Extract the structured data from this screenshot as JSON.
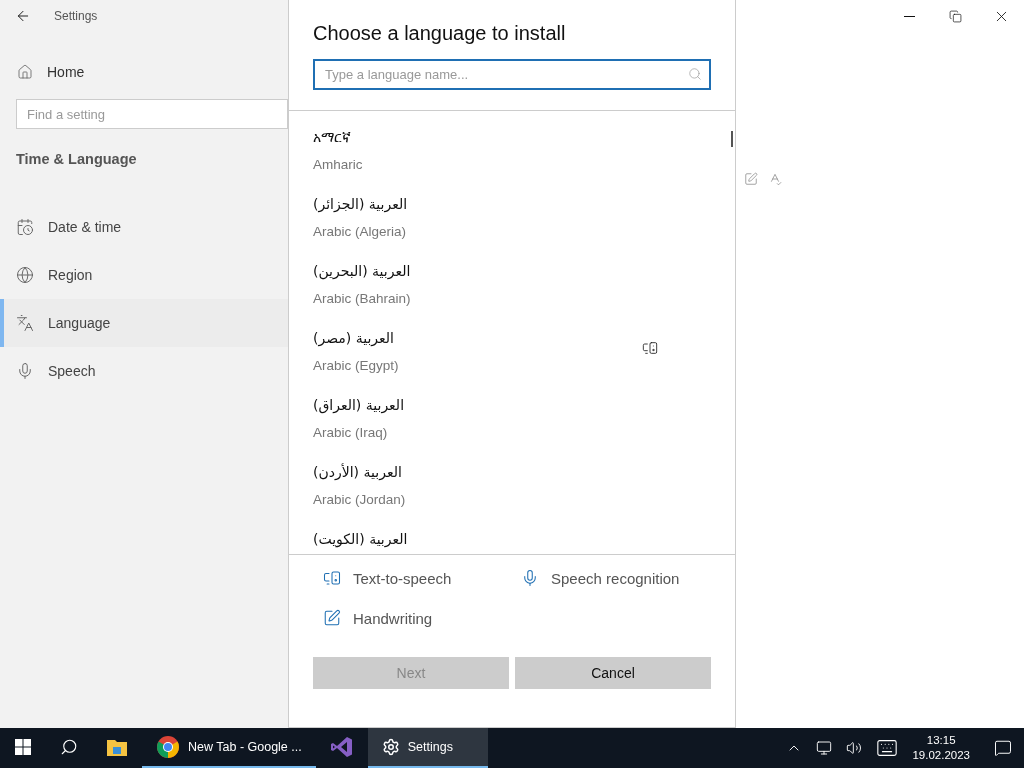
{
  "window": {
    "title": "Settings"
  },
  "sidebar": {
    "home": "Home",
    "search": {
      "placeholder": "Find a setting"
    },
    "heading": "Time & Language",
    "items": [
      {
        "label": "Date & time",
        "kind": "calendar",
        "selected": false
      },
      {
        "label": "Region",
        "kind": "globe",
        "selected": false
      },
      {
        "label": "Language",
        "kind": "language",
        "selected": true
      },
      {
        "label": "Speech",
        "kind": "mic",
        "selected": false
      }
    ]
  },
  "dialog": {
    "title": "Choose a language to install",
    "search": {
      "placeholder": "Type a language name..."
    },
    "languages": [
      {
        "native": "አማርኛ",
        "name": "Amharic",
        "text_to_speech": false
      },
      {
        "native": "العربية (الجزائر)",
        "name": "Arabic (Algeria)",
        "text_to_speech": false
      },
      {
        "native": "العربية (البحرين)",
        "name": "Arabic (Bahrain)",
        "text_to_speech": false
      },
      {
        "native": "العربية (مصر)",
        "name": "Arabic (Egypt)",
        "text_to_speech": true
      },
      {
        "native": "العربية (العراق)",
        "name": "Arabic (Iraq)",
        "text_to_speech": false
      },
      {
        "native": "العربية (الأردن)",
        "name": "Arabic (Jordan)",
        "text_to_speech": false
      },
      {
        "native": "العربية (الكويت)",
        "text_to_speech": false
      }
    ],
    "features": [
      {
        "label": "Text-to-speech",
        "kind": "tts"
      },
      {
        "label": "Speech recognition",
        "kind": "mic"
      },
      {
        "label": "Handwriting",
        "kind": "pen"
      }
    ],
    "buttons": [
      {
        "label": "Next",
        "disabled": true
      },
      {
        "label": "Cancel",
        "disabled": false
      }
    ]
  },
  "taskbar": {
    "apps": [
      {
        "kind": "explorer",
        "selected": false,
        "running": false
      },
      {
        "kind": "chrome",
        "label": "New Tab - Google ...",
        "selected": false,
        "running": true
      },
      {
        "kind": "vs",
        "selected": false,
        "running": false
      },
      {
        "kind": "settings",
        "label": "Settings",
        "selected": true,
        "running": true
      }
    ],
    "time": "13:15",
    "date": "19.02.2023"
  }
}
